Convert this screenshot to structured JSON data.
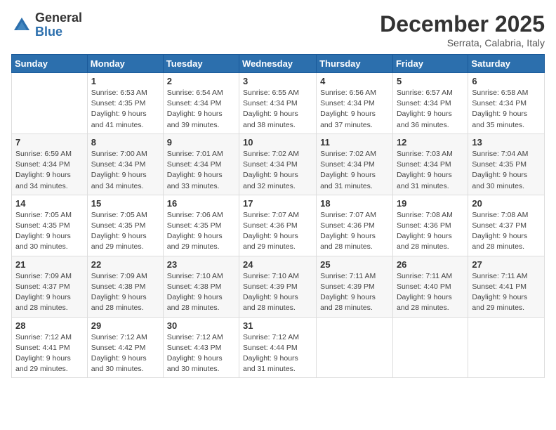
{
  "logo": {
    "general": "General",
    "blue": "Blue"
  },
  "header": {
    "month": "December 2025",
    "location": "Serrata, Calabria, Italy"
  },
  "days_of_week": [
    "Sunday",
    "Monday",
    "Tuesday",
    "Wednesday",
    "Thursday",
    "Friday",
    "Saturday"
  ],
  "weeks": [
    [
      {
        "day": "",
        "sunrise": "",
        "sunset": "",
        "daylight": ""
      },
      {
        "day": "1",
        "sunrise": "Sunrise: 6:53 AM",
        "sunset": "Sunset: 4:35 PM",
        "daylight": "Daylight: 9 hours and 41 minutes."
      },
      {
        "day": "2",
        "sunrise": "Sunrise: 6:54 AM",
        "sunset": "Sunset: 4:34 PM",
        "daylight": "Daylight: 9 hours and 39 minutes."
      },
      {
        "day": "3",
        "sunrise": "Sunrise: 6:55 AM",
        "sunset": "Sunset: 4:34 PM",
        "daylight": "Daylight: 9 hours and 38 minutes."
      },
      {
        "day": "4",
        "sunrise": "Sunrise: 6:56 AM",
        "sunset": "Sunset: 4:34 PM",
        "daylight": "Daylight: 9 hours and 37 minutes."
      },
      {
        "day": "5",
        "sunrise": "Sunrise: 6:57 AM",
        "sunset": "Sunset: 4:34 PM",
        "daylight": "Daylight: 9 hours and 36 minutes."
      },
      {
        "day": "6",
        "sunrise": "Sunrise: 6:58 AM",
        "sunset": "Sunset: 4:34 PM",
        "daylight": "Daylight: 9 hours and 35 minutes."
      }
    ],
    [
      {
        "day": "7",
        "sunrise": "Sunrise: 6:59 AM",
        "sunset": "Sunset: 4:34 PM",
        "daylight": "Daylight: 9 hours and 34 minutes."
      },
      {
        "day": "8",
        "sunrise": "Sunrise: 7:00 AM",
        "sunset": "Sunset: 4:34 PM",
        "daylight": "Daylight: 9 hours and 34 minutes."
      },
      {
        "day": "9",
        "sunrise": "Sunrise: 7:01 AM",
        "sunset": "Sunset: 4:34 PM",
        "daylight": "Daylight: 9 hours and 33 minutes."
      },
      {
        "day": "10",
        "sunrise": "Sunrise: 7:02 AM",
        "sunset": "Sunset: 4:34 PM",
        "daylight": "Daylight: 9 hours and 32 minutes."
      },
      {
        "day": "11",
        "sunrise": "Sunrise: 7:02 AM",
        "sunset": "Sunset: 4:34 PM",
        "daylight": "Daylight: 9 hours and 31 minutes."
      },
      {
        "day": "12",
        "sunrise": "Sunrise: 7:03 AM",
        "sunset": "Sunset: 4:34 PM",
        "daylight": "Daylight: 9 hours and 31 minutes."
      },
      {
        "day": "13",
        "sunrise": "Sunrise: 7:04 AM",
        "sunset": "Sunset: 4:35 PM",
        "daylight": "Daylight: 9 hours and 30 minutes."
      }
    ],
    [
      {
        "day": "14",
        "sunrise": "Sunrise: 7:05 AM",
        "sunset": "Sunset: 4:35 PM",
        "daylight": "Daylight: 9 hours and 30 minutes."
      },
      {
        "day": "15",
        "sunrise": "Sunrise: 7:05 AM",
        "sunset": "Sunset: 4:35 PM",
        "daylight": "Daylight: 9 hours and 29 minutes."
      },
      {
        "day": "16",
        "sunrise": "Sunrise: 7:06 AM",
        "sunset": "Sunset: 4:35 PM",
        "daylight": "Daylight: 9 hours and 29 minutes."
      },
      {
        "day": "17",
        "sunrise": "Sunrise: 7:07 AM",
        "sunset": "Sunset: 4:36 PM",
        "daylight": "Daylight: 9 hours and 29 minutes."
      },
      {
        "day": "18",
        "sunrise": "Sunrise: 7:07 AM",
        "sunset": "Sunset: 4:36 PM",
        "daylight": "Daylight: 9 hours and 28 minutes."
      },
      {
        "day": "19",
        "sunrise": "Sunrise: 7:08 AM",
        "sunset": "Sunset: 4:36 PM",
        "daylight": "Daylight: 9 hours and 28 minutes."
      },
      {
        "day": "20",
        "sunrise": "Sunrise: 7:08 AM",
        "sunset": "Sunset: 4:37 PM",
        "daylight": "Daylight: 9 hours and 28 minutes."
      }
    ],
    [
      {
        "day": "21",
        "sunrise": "Sunrise: 7:09 AM",
        "sunset": "Sunset: 4:37 PM",
        "daylight": "Daylight: 9 hours and 28 minutes."
      },
      {
        "day": "22",
        "sunrise": "Sunrise: 7:09 AM",
        "sunset": "Sunset: 4:38 PM",
        "daylight": "Daylight: 9 hours and 28 minutes."
      },
      {
        "day": "23",
        "sunrise": "Sunrise: 7:10 AM",
        "sunset": "Sunset: 4:38 PM",
        "daylight": "Daylight: 9 hours and 28 minutes."
      },
      {
        "day": "24",
        "sunrise": "Sunrise: 7:10 AM",
        "sunset": "Sunset: 4:39 PM",
        "daylight": "Daylight: 9 hours and 28 minutes."
      },
      {
        "day": "25",
        "sunrise": "Sunrise: 7:11 AM",
        "sunset": "Sunset: 4:39 PM",
        "daylight": "Daylight: 9 hours and 28 minutes."
      },
      {
        "day": "26",
        "sunrise": "Sunrise: 7:11 AM",
        "sunset": "Sunset: 4:40 PM",
        "daylight": "Daylight: 9 hours and 28 minutes."
      },
      {
        "day": "27",
        "sunrise": "Sunrise: 7:11 AM",
        "sunset": "Sunset: 4:41 PM",
        "daylight": "Daylight: 9 hours and 29 minutes."
      }
    ],
    [
      {
        "day": "28",
        "sunrise": "Sunrise: 7:12 AM",
        "sunset": "Sunset: 4:41 PM",
        "daylight": "Daylight: 9 hours and 29 minutes."
      },
      {
        "day": "29",
        "sunrise": "Sunrise: 7:12 AM",
        "sunset": "Sunset: 4:42 PM",
        "daylight": "Daylight: 9 hours and 30 minutes."
      },
      {
        "day": "30",
        "sunrise": "Sunrise: 7:12 AM",
        "sunset": "Sunset: 4:43 PM",
        "daylight": "Daylight: 9 hours and 30 minutes."
      },
      {
        "day": "31",
        "sunrise": "Sunrise: 7:12 AM",
        "sunset": "Sunset: 4:44 PM",
        "daylight": "Daylight: 9 hours and 31 minutes."
      },
      {
        "day": "",
        "sunrise": "",
        "sunset": "",
        "daylight": ""
      },
      {
        "day": "",
        "sunrise": "",
        "sunset": "",
        "daylight": ""
      },
      {
        "day": "",
        "sunrise": "",
        "sunset": "",
        "daylight": ""
      }
    ]
  ]
}
